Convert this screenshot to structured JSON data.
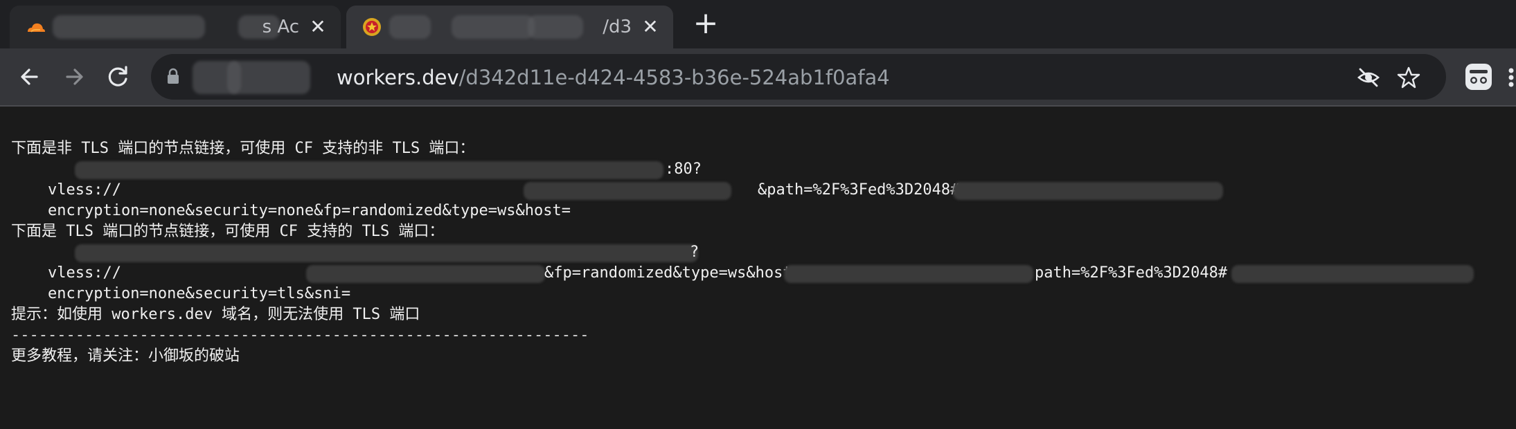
{
  "tabs": [
    {
      "title": "s Ac",
      "close": "✕",
      "icon": "cloudflare-icon"
    },
    {
      "title": "/d3",
      "close": "✕",
      "icon": "emblem-icon"
    }
  ],
  "new_tab": "+",
  "toolbar": {
    "url_domain": "workers.dev",
    "url_path": "/d342d11e-d424-4583-b36e-524ab1f0afa4"
  },
  "content": {
    "heading_non_tls": "下面是非 TLS 端口的节点链接，可使用 CF 支持的非 TLS 端口：",
    "vless1_start": "vless://",
    "vless1_end": ":80?",
    "enc1_a": "encryption=none&security=none&fp=randomized&type=ws&host=",
    "enc1_b": "&path=%2F%3Fed%3D2048#",
    "heading_tls": "下面是 TLS 端口的节点链接，可使用 CF 支持的 TLS 端口：",
    "vless2_start": "vless://",
    "vless2_end": "?",
    "enc2_a": "encryption=none&security=tls&sni=",
    "enc2_b": "&fp=randomized&type=ws&host=",
    "enc2_c": "path=%2F%3Fed%3D2048#",
    "tip": "提示：如使用 workers.dev 域名，则无法使用 TLS 端口",
    "separator": "---------------------------------------------------------------",
    "more": "更多教程，请关注：小御坂的破站"
  },
  "colors": {
    "page_bg": "#1b1b1b",
    "toolbar_bg": "#35363a",
    "tabstrip_bg": "#1f2023",
    "omnibox_bg": "#202124",
    "text": "#f0f0f0"
  }
}
